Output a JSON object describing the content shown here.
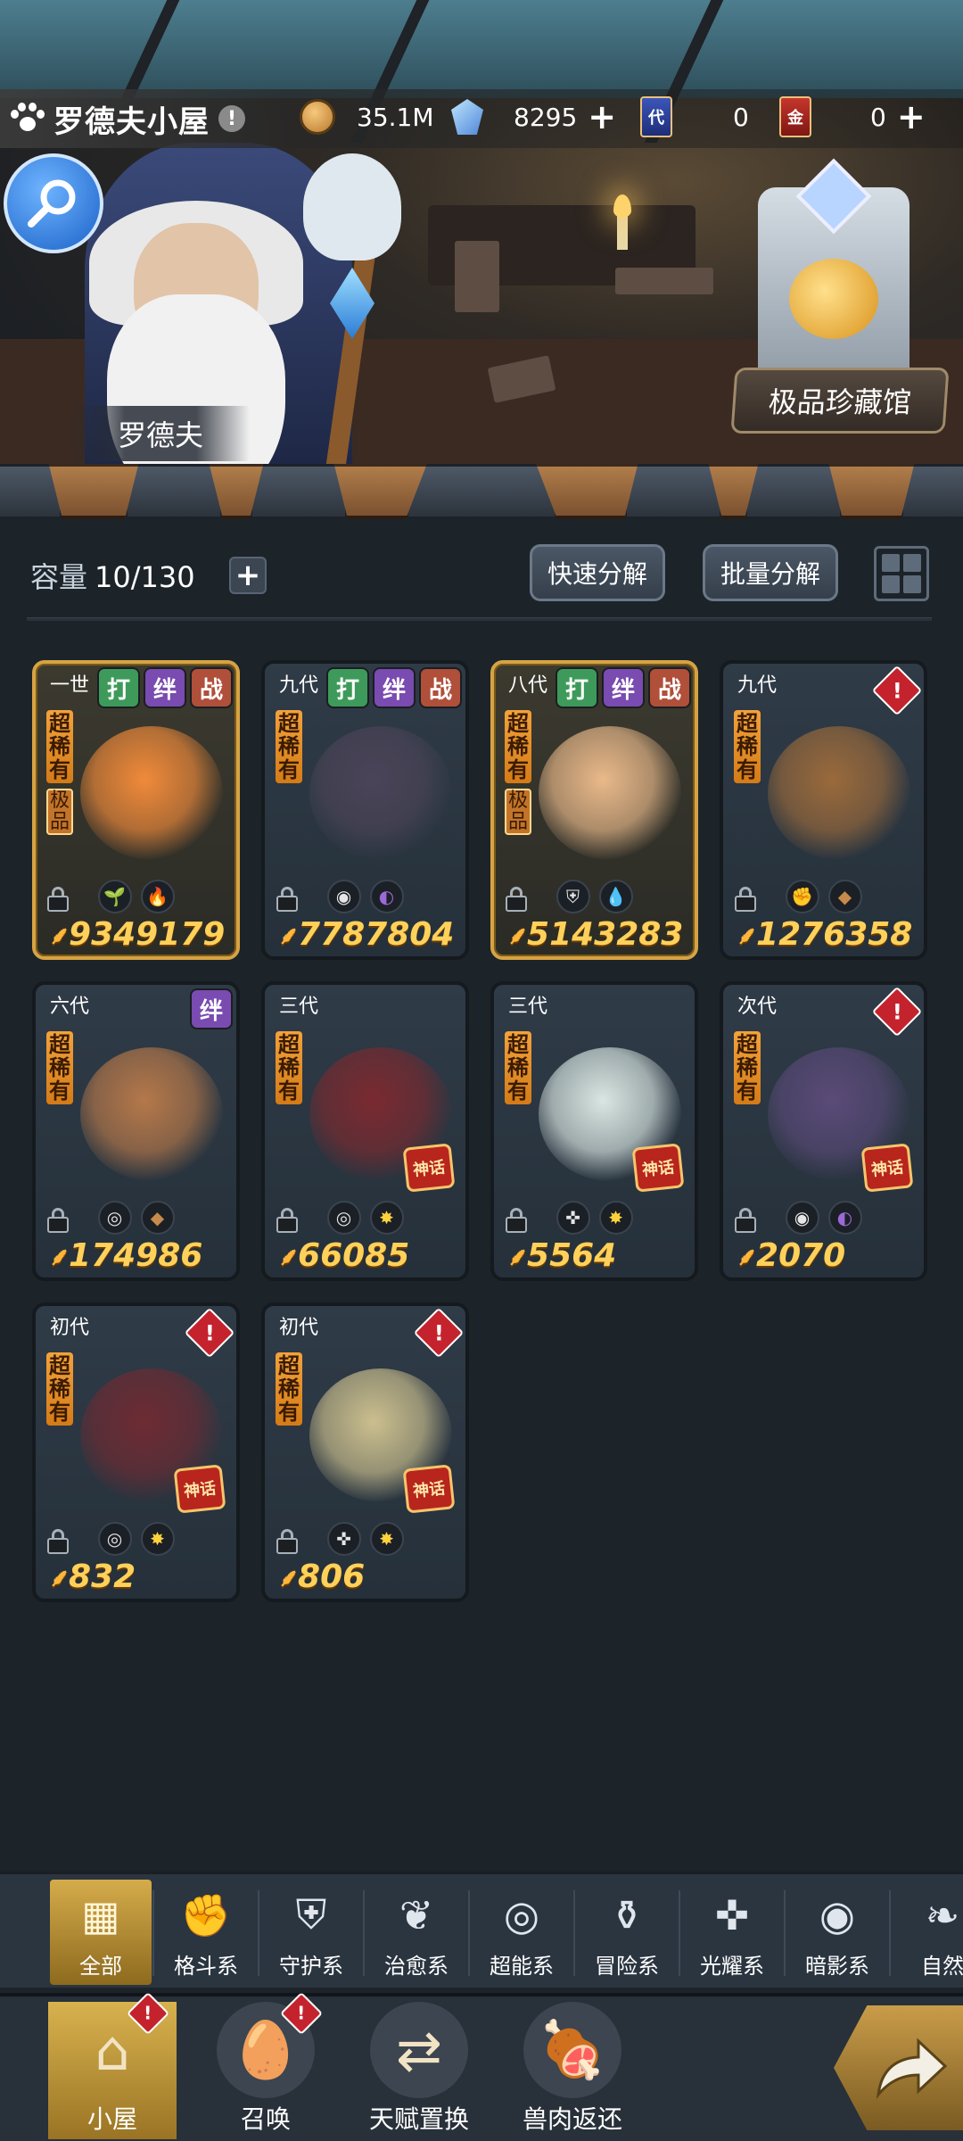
{
  "header": {
    "title": "罗德夫小屋",
    "title_alert": "!",
    "resources": [
      {
        "icon": "gold-coin-icon",
        "value": "35.1M",
        "has_plus": false
      },
      {
        "icon": "crystal-icon",
        "value": "8295",
        "has_plus": true
      },
      {
        "icon": "dai-card-icon",
        "label": "代",
        "value": "0",
        "has_plus": false
      },
      {
        "icon": "jin-card-icon",
        "label": "金",
        "value": "0",
        "has_plus": true
      }
    ],
    "plus_symbol": "+"
  },
  "scene": {
    "npc_name": "罗德夫",
    "museum_label": "极品珍藏馆"
  },
  "toolbar": {
    "capacity_label": "容量",
    "capacity_value": "10/130",
    "plus": "+",
    "quick_decompose": "快速分解",
    "batch_decompose": "批量分解"
  },
  "pets": [
    {
      "gen": "一世",
      "tags": [
        "打",
        "绊",
        "战"
      ],
      "alert": false,
      "rarity": "超稀有",
      "extra": "极品",
      "seal": false,
      "gold": true,
      "elements": [
        "plant-icon",
        "fire-icon"
      ],
      "power": "9349179",
      "art_color": "#f08a3a"
    },
    {
      "gen": "九代",
      "tags": [
        "打",
        "绊",
        "战"
      ],
      "alert": false,
      "rarity": "超稀有",
      "extra": "",
      "seal": false,
      "gold": false,
      "elements": [
        "shadow-eye-icon",
        "moon-icon"
      ],
      "power": "7787804",
      "art_color": "#4b4458"
    },
    {
      "gen": "八代",
      "tags": [
        "打",
        "绊",
        "战"
      ],
      "alert": false,
      "rarity": "超稀有",
      "extra": "极品",
      "seal": false,
      "gold": true,
      "elements": [
        "shield-icon",
        "water-drop-icon"
      ],
      "power": "5143283",
      "art_color": "#e9b98a"
    },
    {
      "gen": "九代",
      "tags": [],
      "alert": true,
      "rarity": "超稀有",
      "extra": "",
      "seal": false,
      "gold": false,
      "elements": [
        "fist-icon",
        "rock-icon"
      ],
      "power": "1276358",
      "art_color": "#9a6a3c"
    },
    {
      "gen": "六代",
      "tags": [
        "绊"
      ],
      "alert": false,
      "rarity": "超稀有",
      "extra": "",
      "seal": false,
      "gold": false,
      "elements": [
        "psychic-icon",
        "rock-icon"
      ],
      "power": "174986",
      "art_color": "#b5784a"
    },
    {
      "gen": "三代",
      "tags": [],
      "alert": false,
      "rarity": "超稀有",
      "extra": "",
      "seal": true,
      "gold": false,
      "elements": [
        "psychic-icon",
        "light-star-icon"
      ],
      "power": "66085",
      "art_color": "#7a2a30"
    },
    {
      "gen": "三代",
      "tags": [],
      "alert": false,
      "rarity": "超稀有",
      "extra": "",
      "seal": true,
      "gold": false,
      "elements": [
        "crosshair-icon",
        "light-star-icon"
      ],
      "power": "5564",
      "art_color": "#d9e6e2"
    },
    {
      "gen": "次代",
      "tags": [],
      "alert": true,
      "rarity": "超稀有",
      "extra": "",
      "seal": true,
      "gold": false,
      "elements": [
        "shadow-eye-icon",
        "moon-icon"
      ],
      "power": "2070",
      "art_color": "#5a4a78"
    },
    {
      "gen": "初代",
      "tags": [],
      "alert": true,
      "rarity": "超稀有",
      "extra": "",
      "seal": true,
      "gold": false,
      "elements": [
        "psychic-icon",
        "light-star-icon"
      ],
      "power": "832",
      "art_color": "#6e2b33"
    },
    {
      "gen": "初代",
      "tags": [],
      "alert": true,
      "rarity": "超稀有",
      "extra": "",
      "seal": true,
      "gold": false,
      "elements": [
        "crosshair-icon",
        "light-star-icon"
      ],
      "power": "806",
      "art_color": "#cbbf8e"
    }
  ],
  "seal_text": "神话",
  "filters": [
    {
      "label": "全部",
      "icon": "all-blocks-icon",
      "active": true
    },
    {
      "label": "格斗系",
      "icon": "fist-icon",
      "active": false
    },
    {
      "label": "守护系",
      "icon": "shield-icon",
      "active": false
    },
    {
      "label": "治愈系",
      "icon": "sprout-icon",
      "active": false
    },
    {
      "label": "超能系",
      "icon": "psychic-icon",
      "active": false
    },
    {
      "label": "冒险系",
      "icon": "lantern-icon",
      "active": false
    },
    {
      "label": "光耀系",
      "icon": "crosshair-icon",
      "active": false
    },
    {
      "label": "暗影系",
      "icon": "shadow-eye-icon",
      "active": false
    },
    {
      "label": "自然",
      "icon": "leaf-icon",
      "active": false
    }
  ],
  "nav": [
    {
      "label": "小屋",
      "icon": "house-icon",
      "active": true,
      "alert": true
    },
    {
      "label": "召唤",
      "icon": "egg-icon",
      "active": false,
      "alert": true
    },
    {
      "label": "天赋置换",
      "icon": "swap-arrows-icon",
      "active": false,
      "alert": false
    },
    {
      "label": "兽肉返还",
      "icon": "meat-icon",
      "active": false,
      "alert": false
    }
  ],
  "alert_symbol": "!",
  "colors": {
    "gold_power": "#ffd15a",
    "alert_red": "#c4232d",
    "active_tab": "#d5ac4b"
  }
}
